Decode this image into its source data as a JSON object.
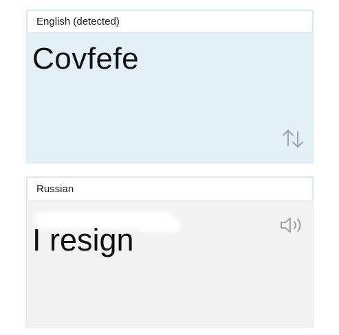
{
  "source": {
    "language_label": "English (detected)",
    "text": "Covfefe",
    "swap_icon": "swap-arrows-icon"
  },
  "target": {
    "language_label": "Russian",
    "text": "I resign",
    "speaker_icon": "speaker-icon"
  },
  "colors": {
    "source_background": "#e3f0f7",
    "target_background": "#f2f2f2",
    "icon_gray": "#9a9a9a"
  }
}
